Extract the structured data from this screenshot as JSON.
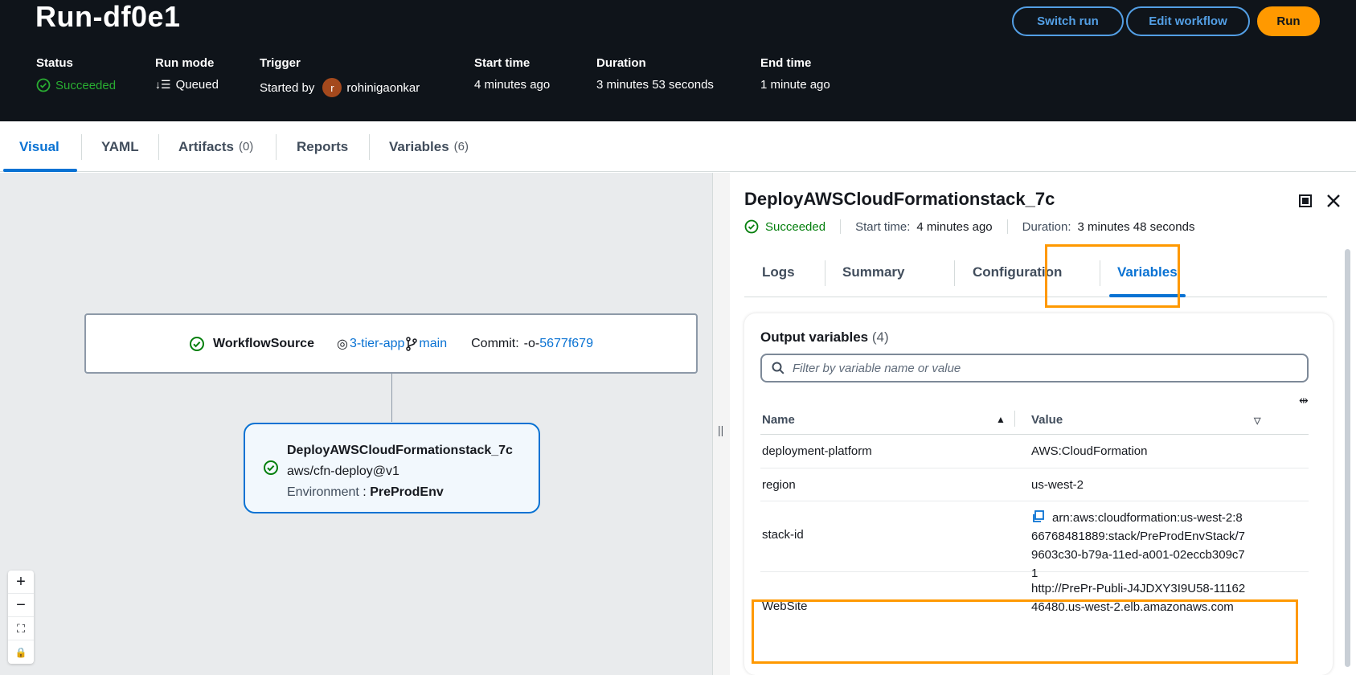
{
  "header": {
    "title": "Run-df0e1",
    "buttons": {
      "switch_run": "Switch run",
      "edit_workflow": "Edit workflow",
      "run": "Run"
    },
    "meta": {
      "status_label": "Status",
      "status_value": "Succeeded",
      "run_mode_label": "Run mode",
      "run_mode_value": "Queued",
      "trigger_label": "Trigger",
      "trigger_prefix": "Started by",
      "trigger_user_initial": "r",
      "trigger_user": "rohinigaonkar",
      "start_label": "Start time",
      "start_value": "4 minutes ago",
      "duration_label": "Duration",
      "duration_value": "3 minutes 53 seconds",
      "end_label": "End time",
      "end_value": "1 minute ago"
    }
  },
  "tabs": [
    {
      "label": "Visual",
      "count": ""
    },
    {
      "label": "YAML",
      "count": ""
    },
    {
      "label": "Artifacts",
      "count": "(0)"
    },
    {
      "label": "Reports",
      "count": ""
    },
    {
      "label": "Variables",
      "count": "(6)"
    }
  ],
  "canvas": {
    "source_node": {
      "name": "WorkflowSource",
      "repo": "3-tier-app",
      "branch": "main",
      "commit_label": "Commit:",
      "commit": "5677f679"
    },
    "deploy_node": {
      "name": "DeployAWSCloudFormationstack_7c",
      "action": "aws/cfn-deploy@v1",
      "env_label": "Environment",
      "env_sep": ":",
      "env_value": "PreProdEnv"
    },
    "zoom": {
      "in": "+",
      "out": "−",
      "fit": "⛶",
      "lock": "🔒"
    }
  },
  "panel": {
    "title": "DeployAWSCloudFormationstack_7c",
    "status": "Succeeded",
    "start_label": "Start time:",
    "start_value": "4 minutes ago",
    "duration_label": "Duration:",
    "duration_value": "3 minutes 48 seconds",
    "tabs": [
      "Logs",
      "Summary",
      "Configuration",
      "Variables"
    ],
    "output": {
      "title": "Output variables",
      "count": "(4)",
      "filter_placeholder": "Filter by variable name or value",
      "col_name": "Name",
      "col_value": "Value",
      "rows": [
        {
          "name": "deployment-platform",
          "value": "AWS:CloudFormation"
        },
        {
          "name": "region",
          "value": "us-west-2"
        },
        {
          "name": "stack-id",
          "value": "arn:aws:cloudformation:us-west-2:866768481889:stack/PreProdEnvStack/79603c30-b79a-11ed-a001-02eccb309c71"
        },
        {
          "name": "WebSite",
          "value": "http://PrePr-Publi-J4JDXY3I9U58-1116246480.us-west-2.elb.amazonaws.com"
        }
      ]
    }
  },
  "colors": {
    "accent": "#0972d3",
    "highlight": "#ff9900",
    "success": "#037f0c",
    "header_bg": "#0f141a"
  }
}
